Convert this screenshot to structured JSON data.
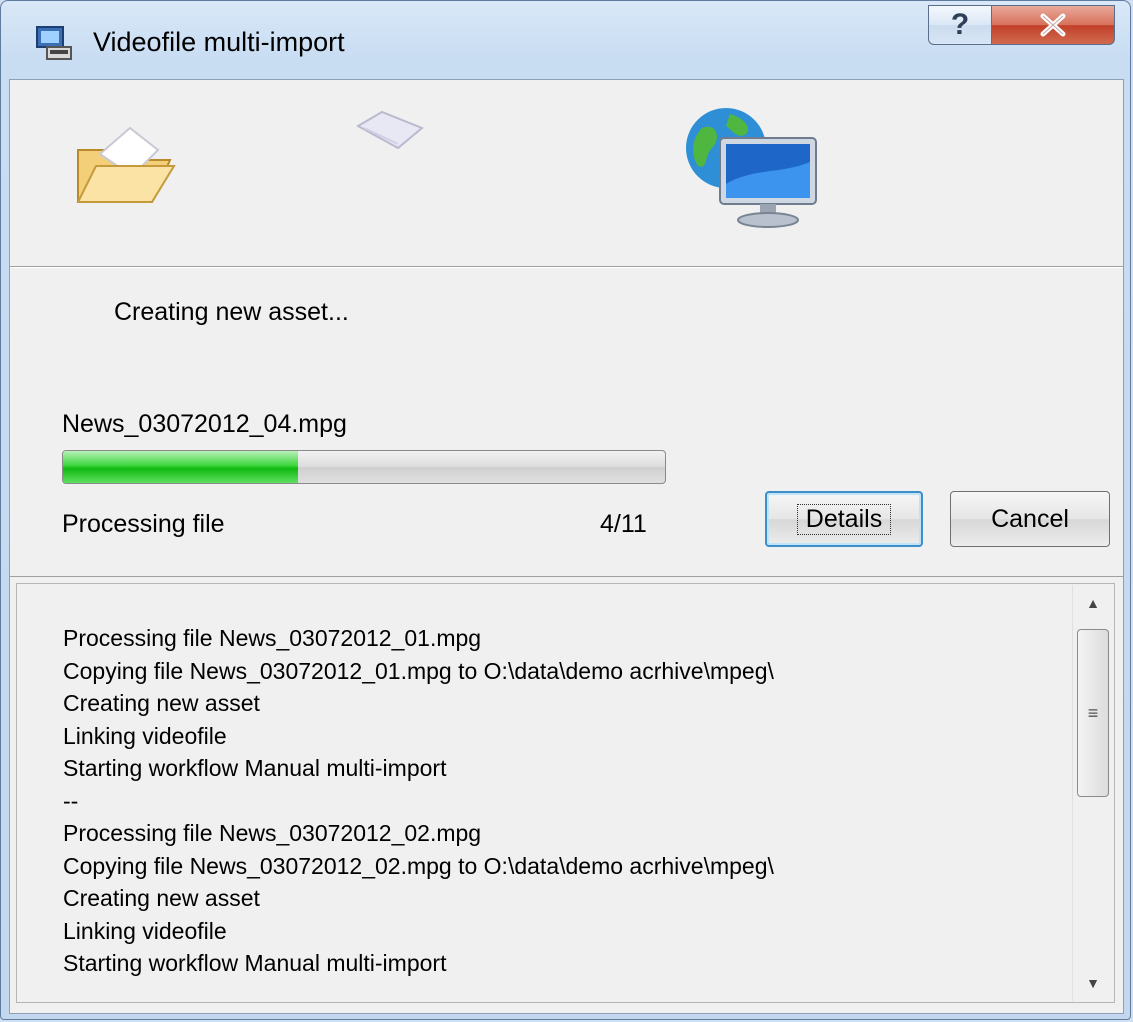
{
  "window": {
    "title": "Videofile multi-import"
  },
  "titlebar": {
    "help_label": "?",
    "close_label": "X"
  },
  "status": {
    "text": "Creating new asset..."
  },
  "current_file": {
    "name": "News_03072012_04.mpg",
    "progress_fraction": 0.39
  },
  "processing": {
    "label": "Processing file",
    "count": "4/11"
  },
  "buttons": {
    "details": "Details",
    "cancel": "Cancel"
  },
  "log": {
    "lines": [
      "Processing file News_03072012_01.mpg",
      "Copying file News_03072012_01.mpg to O:\\data\\demo acrhive\\mpeg\\",
      "Creating new asset",
      "Linking videofile",
      "Starting workflow Manual multi-import",
      "--",
      "Processing file News_03072012_02.mpg",
      "Copying file News_03072012_02.mpg to O:\\data\\demo acrhive\\mpeg\\",
      "Creating new asset",
      "Linking videofile",
      "Starting workflow Manual multi-import"
    ]
  },
  "scrollbar": {
    "grip_glyph": "≡",
    "up_glyph": "▲",
    "down_glyph": "▼"
  },
  "colors": {
    "progress_green": "#11b811",
    "focus_blue": "#3d8ec9",
    "close_red": "#c2402a"
  }
}
